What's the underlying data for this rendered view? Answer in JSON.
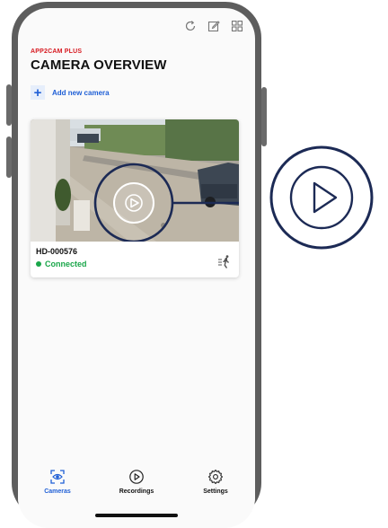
{
  "app": {
    "brand": "APP2CAM PLUS",
    "title": "CAMERA OVERVIEW"
  },
  "toolbar": {
    "icons": [
      "refresh-icon",
      "edit-icon",
      "grid-icon"
    ]
  },
  "add_camera": {
    "label": "Add new camera",
    "icon": "plus-icon"
  },
  "camera": {
    "name": "HD-000576",
    "status": "Connected",
    "status_color": "#1aa64a"
  },
  "tabs": [
    {
      "label": "Cameras",
      "icon": "camera-icon",
      "active": true
    },
    {
      "label": "Recordings",
      "icon": "play-circle-icon",
      "active": false
    },
    {
      "label": "Settings",
      "icon": "gear-icon",
      "active": false
    }
  ],
  "colors": {
    "brand": "#d71920",
    "accent": "#1f5fd6",
    "callout": "#1c2a55"
  }
}
